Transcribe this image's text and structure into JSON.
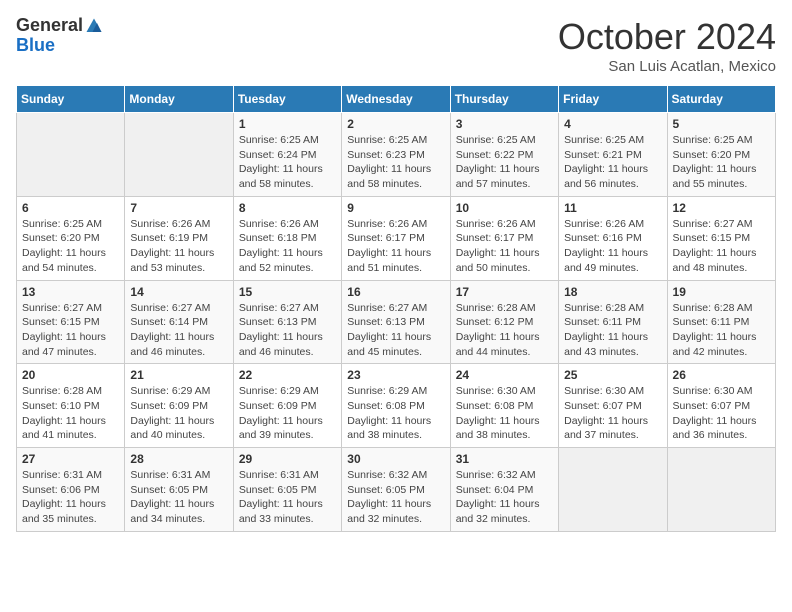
{
  "header": {
    "logo_general": "General",
    "logo_blue": "Blue",
    "month_title": "October 2024",
    "location": "San Luis Acatlan, Mexico"
  },
  "days_of_week": [
    "Sunday",
    "Monday",
    "Tuesday",
    "Wednesday",
    "Thursday",
    "Friday",
    "Saturday"
  ],
  "weeks": [
    [
      {
        "day": "",
        "info": ""
      },
      {
        "day": "",
        "info": ""
      },
      {
        "day": "1",
        "info": "Sunrise: 6:25 AM\nSunset: 6:24 PM\nDaylight: 11 hours and 58 minutes."
      },
      {
        "day": "2",
        "info": "Sunrise: 6:25 AM\nSunset: 6:23 PM\nDaylight: 11 hours and 58 minutes."
      },
      {
        "day": "3",
        "info": "Sunrise: 6:25 AM\nSunset: 6:22 PM\nDaylight: 11 hours and 57 minutes."
      },
      {
        "day": "4",
        "info": "Sunrise: 6:25 AM\nSunset: 6:21 PM\nDaylight: 11 hours and 56 minutes."
      },
      {
        "day": "5",
        "info": "Sunrise: 6:25 AM\nSunset: 6:20 PM\nDaylight: 11 hours and 55 minutes."
      }
    ],
    [
      {
        "day": "6",
        "info": "Sunrise: 6:25 AM\nSunset: 6:20 PM\nDaylight: 11 hours and 54 minutes."
      },
      {
        "day": "7",
        "info": "Sunrise: 6:26 AM\nSunset: 6:19 PM\nDaylight: 11 hours and 53 minutes."
      },
      {
        "day": "8",
        "info": "Sunrise: 6:26 AM\nSunset: 6:18 PM\nDaylight: 11 hours and 52 minutes."
      },
      {
        "day": "9",
        "info": "Sunrise: 6:26 AM\nSunset: 6:17 PM\nDaylight: 11 hours and 51 minutes."
      },
      {
        "day": "10",
        "info": "Sunrise: 6:26 AM\nSunset: 6:17 PM\nDaylight: 11 hours and 50 minutes."
      },
      {
        "day": "11",
        "info": "Sunrise: 6:26 AM\nSunset: 6:16 PM\nDaylight: 11 hours and 49 minutes."
      },
      {
        "day": "12",
        "info": "Sunrise: 6:27 AM\nSunset: 6:15 PM\nDaylight: 11 hours and 48 minutes."
      }
    ],
    [
      {
        "day": "13",
        "info": "Sunrise: 6:27 AM\nSunset: 6:15 PM\nDaylight: 11 hours and 47 minutes."
      },
      {
        "day": "14",
        "info": "Sunrise: 6:27 AM\nSunset: 6:14 PM\nDaylight: 11 hours and 46 minutes."
      },
      {
        "day": "15",
        "info": "Sunrise: 6:27 AM\nSunset: 6:13 PM\nDaylight: 11 hours and 46 minutes."
      },
      {
        "day": "16",
        "info": "Sunrise: 6:27 AM\nSunset: 6:13 PM\nDaylight: 11 hours and 45 minutes."
      },
      {
        "day": "17",
        "info": "Sunrise: 6:28 AM\nSunset: 6:12 PM\nDaylight: 11 hours and 44 minutes."
      },
      {
        "day": "18",
        "info": "Sunrise: 6:28 AM\nSunset: 6:11 PM\nDaylight: 11 hours and 43 minutes."
      },
      {
        "day": "19",
        "info": "Sunrise: 6:28 AM\nSunset: 6:11 PM\nDaylight: 11 hours and 42 minutes."
      }
    ],
    [
      {
        "day": "20",
        "info": "Sunrise: 6:28 AM\nSunset: 6:10 PM\nDaylight: 11 hours and 41 minutes."
      },
      {
        "day": "21",
        "info": "Sunrise: 6:29 AM\nSunset: 6:09 PM\nDaylight: 11 hours and 40 minutes."
      },
      {
        "day": "22",
        "info": "Sunrise: 6:29 AM\nSunset: 6:09 PM\nDaylight: 11 hours and 39 minutes."
      },
      {
        "day": "23",
        "info": "Sunrise: 6:29 AM\nSunset: 6:08 PM\nDaylight: 11 hours and 38 minutes."
      },
      {
        "day": "24",
        "info": "Sunrise: 6:30 AM\nSunset: 6:08 PM\nDaylight: 11 hours and 38 minutes."
      },
      {
        "day": "25",
        "info": "Sunrise: 6:30 AM\nSunset: 6:07 PM\nDaylight: 11 hours and 37 minutes."
      },
      {
        "day": "26",
        "info": "Sunrise: 6:30 AM\nSunset: 6:07 PM\nDaylight: 11 hours and 36 minutes."
      }
    ],
    [
      {
        "day": "27",
        "info": "Sunrise: 6:31 AM\nSunset: 6:06 PM\nDaylight: 11 hours and 35 minutes."
      },
      {
        "day": "28",
        "info": "Sunrise: 6:31 AM\nSunset: 6:05 PM\nDaylight: 11 hours and 34 minutes."
      },
      {
        "day": "29",
        "info": "Sunrise: 6:31 AM\nSunset: 6:05 PM\nDaylight: 11 hours and 33 minutes."
      },
      {
        "day": "30",
        "info": "Sunrise: 6:32 AM\nSunset: 6:05 PM\nDaylight: 11 hours and 32 minutes."
      },
      {
        "day": "31",
        "info": "Sunrise: 6:32 AM\nSunset: 6:04 PM\nDaylight: 11 hours and 32 minutes."
      },
      {
        "day": "",
        "info": ""
      },
      {
        "day": "",
        "info": ""
      }
    ]
  ]
}
